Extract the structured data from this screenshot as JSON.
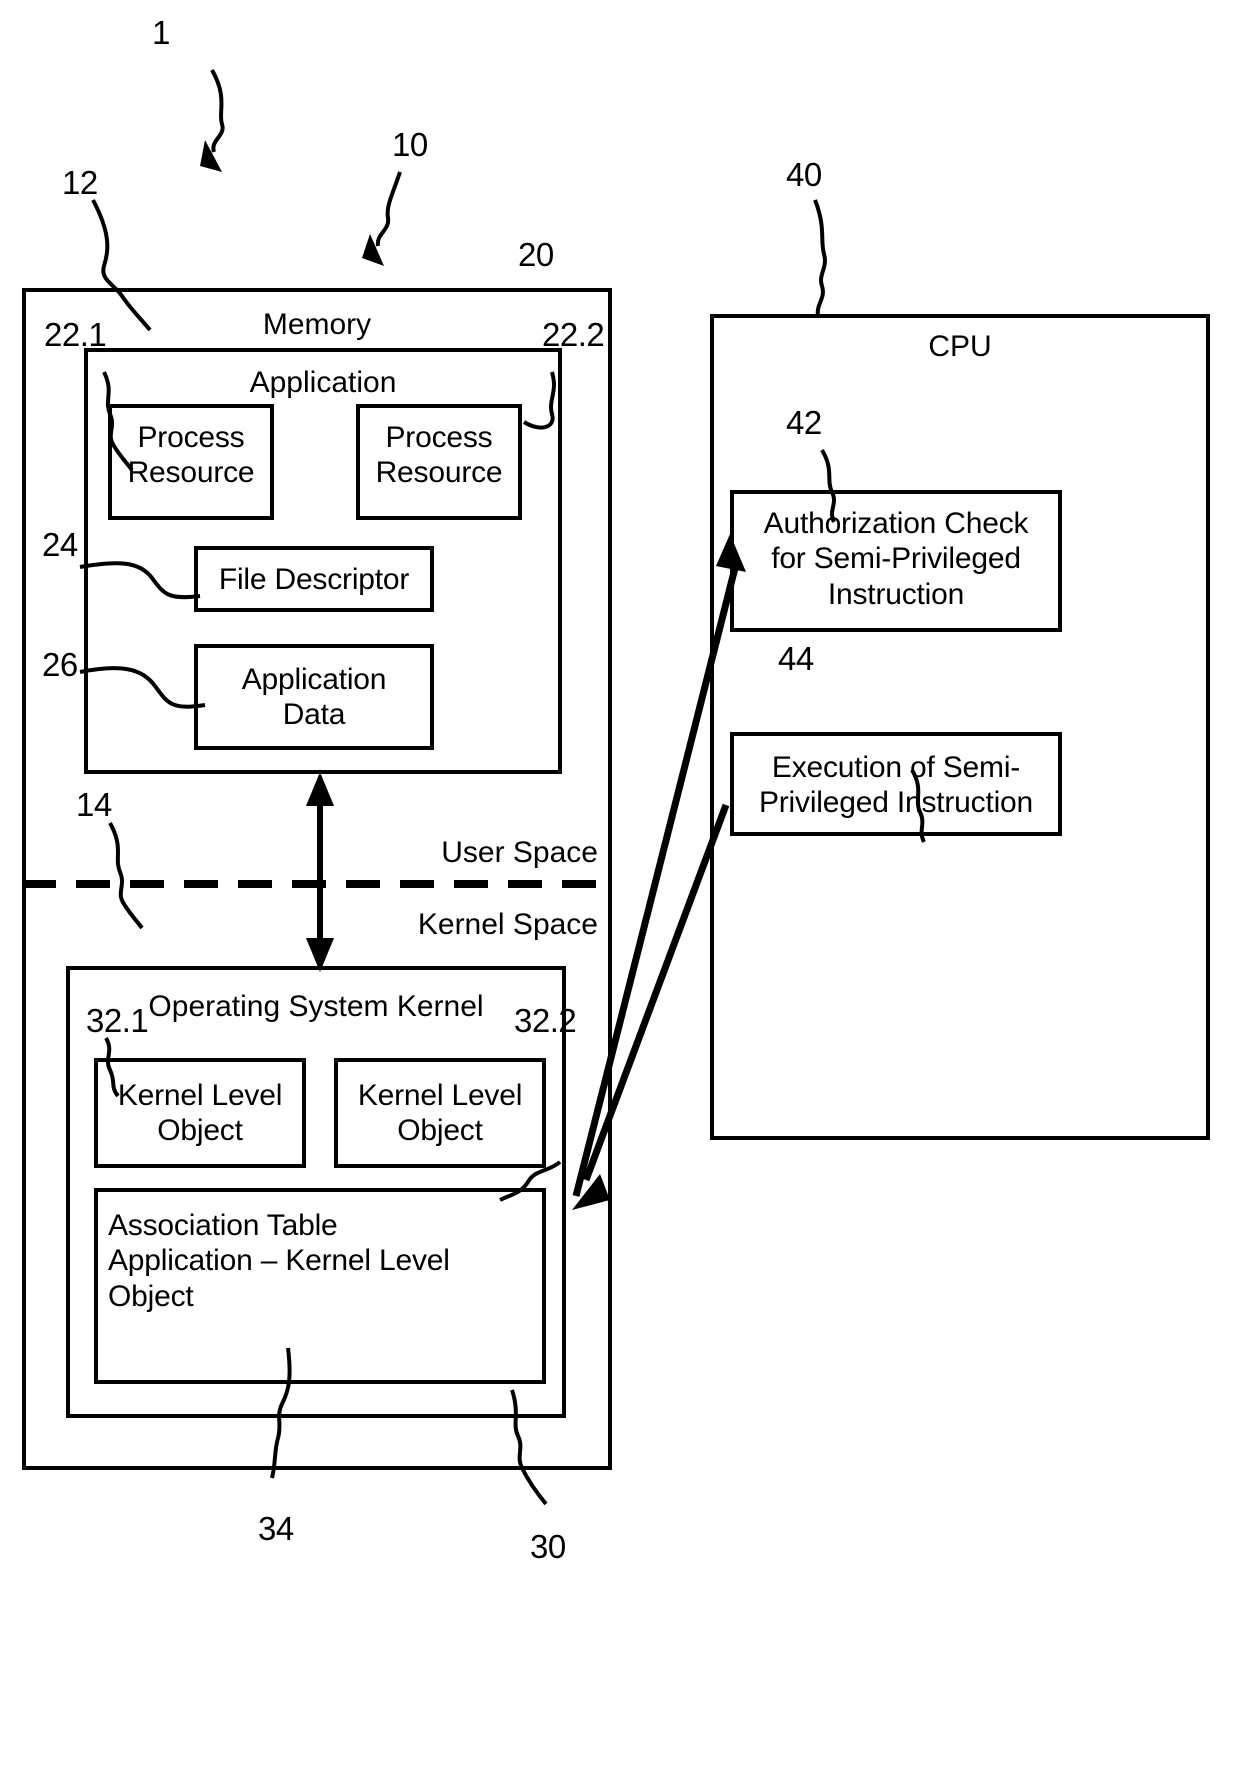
{
  "figure": {
    "type": "patent-block-diagram",
    "system_ref": "1"
  },
  "refs": {
    "system": "1",
    "computer": "10",
    "memory": "12",
    "space_divider": "14",
    "application": "20",
    "process_resource_1": "22.1",
    "process_resource_2": "22.2",
    "file_descriptor": "24",
    "application_data": "26",
    "os_kernel": "30",
    "kernel_level_object_1": "32.1",
    "kernel_level_object_2": "32.2",
    "association_table": "34",
    "cpu": "40",
    "authorization_check": "42",
    "execution": "44"
  },
  "memory": {
    "title": "Memory",
    "application": {
      "title": "Application",
      "process_resource_1": "Process\nResource",
      "process_resource_2": "Process\nResource",
      "file_descriptor": "File Descriptor",
      "application_data": "Application\nData"
    },
    "user_space_label": "User Space",
    "kernel_space_label": "Kernel Space",
    "kernel": {
      "title": "Operating System Kernel",
      "kernel_level_object_1": "Kernel Level\nObject",
      "kernel_level_object_2": "Kernel Level\nObject",
      "association_table": "Association Table\nApplication – Kernel Level Object"
    }
  },
  "cpu": {
    "title": "CPU",
    "authorization_check": "Authorization Check\nfor Semi-Privileged\nInstruction",
    "execution": "Execution of Semi-\nPrivileged Instruction"
  },
  "colors": {
    "stroke": "#000000",
    "background": "#ffffff"
  }
}
